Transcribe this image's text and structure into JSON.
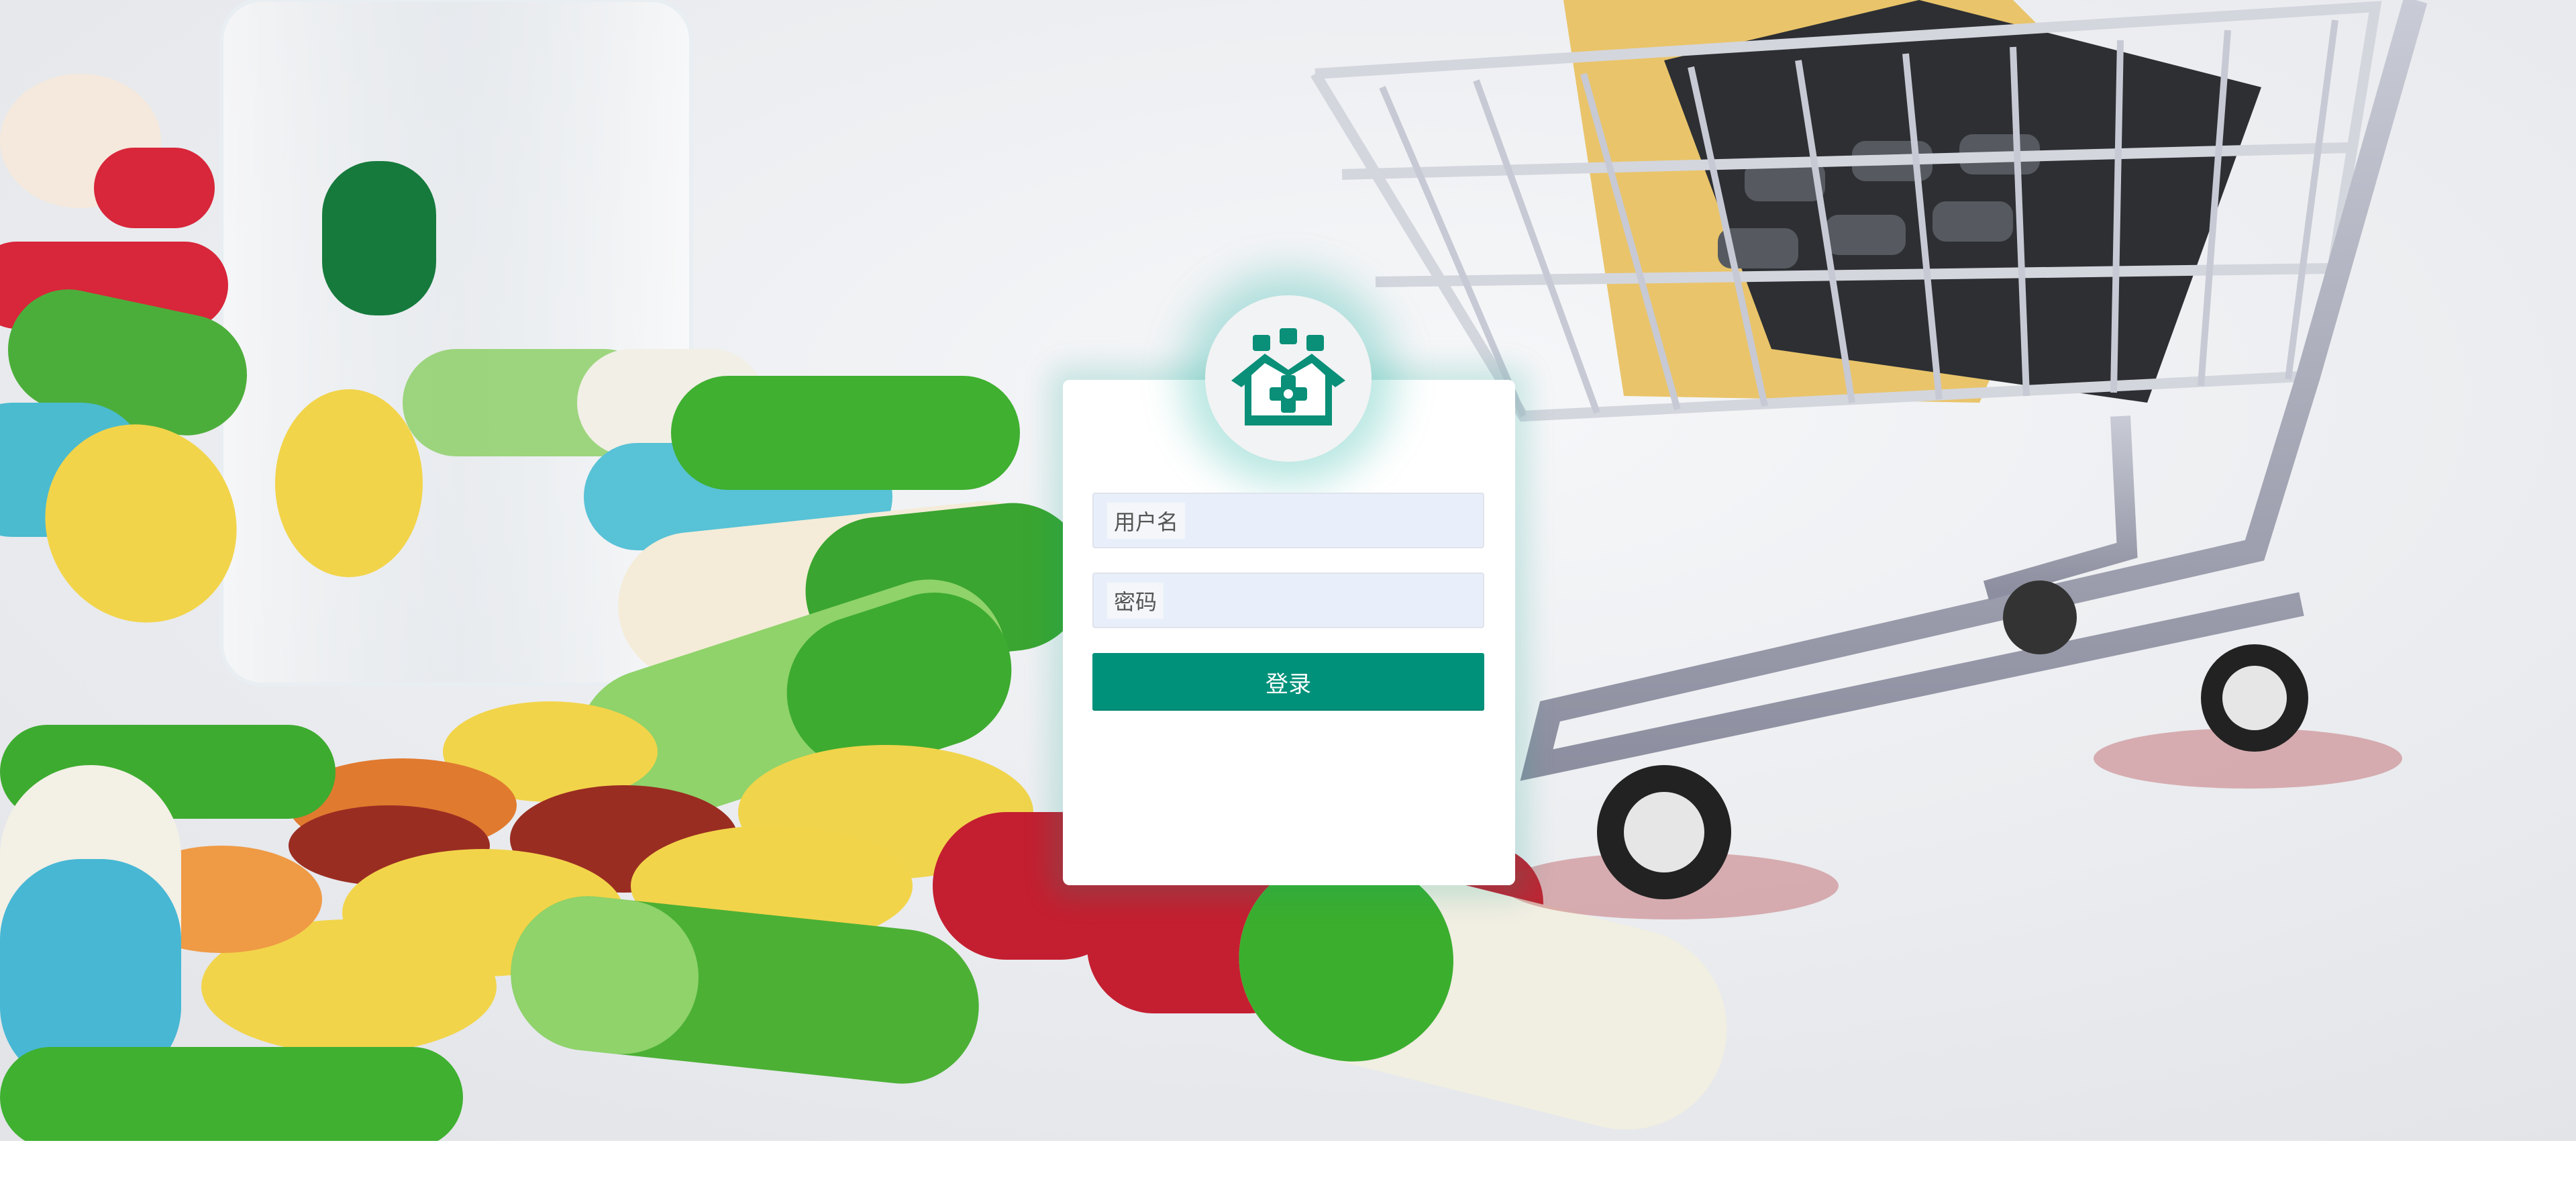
{
  "login": {
    "username_label": "用户名",
    "password_label": "密码",
    "submit_label": "登录"
  },
  "colors": {
    "accent": "#00917b",
    "input_background": "#e8effb",
    "logo_icon": "#0a8f78"
  },
  "icons": {
    "logo": "medical-house-icon"
  }
}
